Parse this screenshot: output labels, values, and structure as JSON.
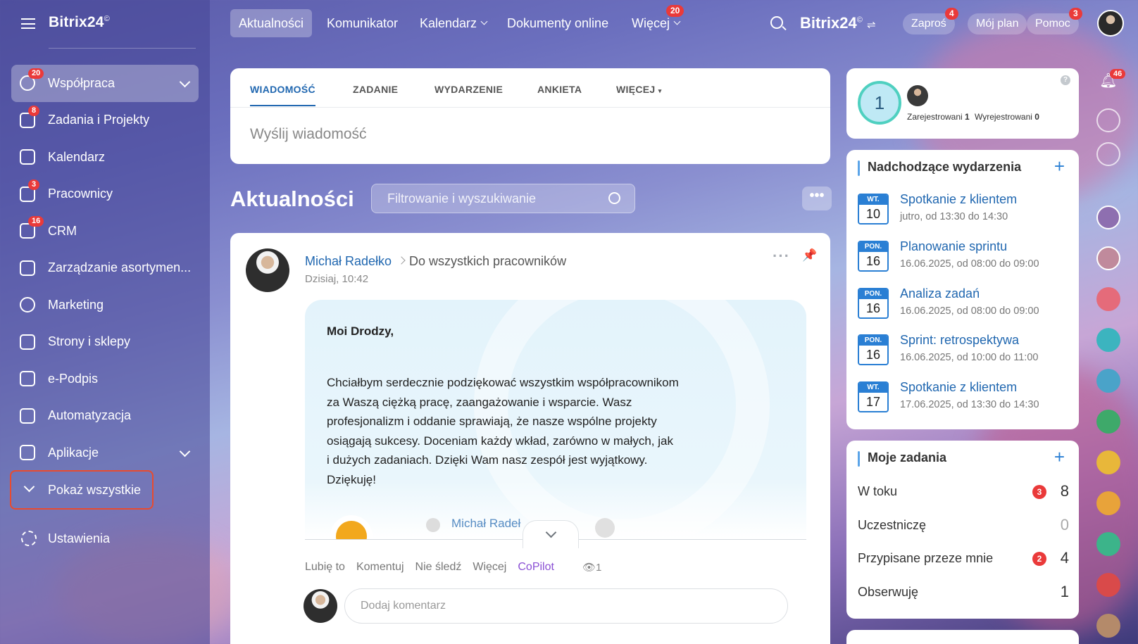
{
  "sidebar": {
    "logo": "Bitrix24",
    "items": [
      {
        "label": "Współpraca",
        "badge": "20"
      },
      {
        "label": "Zadania i Projekty",
        "badge": "8"
      },
      {
        "label": "Kalendarz",
        "badge": ""
      },
      {
        "label": "Pracownicy",
        "badge": "3"
      },
      {
        "label": "CRM",
        "badge": "16"
      },
      {
        "label": "Zarządzanie asortymen...",
        "badge": ""
      },
      {
        "label": "Marketing",
        "badge": ""
      },
      {
        "label": "Strony i sklepy",
        "badge": ""
      },
      {
        "label": "e-Podpis",
        "badge": ""
      },
      {
        "label": "Automatyzacja",
        "badge": ""
      },
      {
        "label": "Aplikacje",
        "badge": ""
      }
    ],
    "show_all": "Pokaż wszystkie",
    "settings": "Ustawienia"
  },
  "header": {
    "tabs": [
      "Aktualności",
      "Komunikator",
      "Kalendarz",
      "Dokumenty online",
      "Więcej"
    ],
    "more_badge": "20",
    "brand": "Bitrix24",
    "invite": "Zaproś",
    "invite_badge": "4",
    "my_plan": "Mój plan",
    "help": "Pomoc",
    "help_badge": "3"
  },
  "composer": {
    "tabs": [
      "WIADOMOŚĆ",
      "ZADANIE",
      "WYDARZENIE",
      "ANKIETA",
      "WIĘCEJ"
    ],
    "placeholder": "Wyślij wiadomość"
  },
  "feed": {
    "title": "Aktualności",
    "filter_placeholder": "Filtrowanie i wyszukiwanie",
    "dots": "•••"
  },
  "post": {
    "author": "Michał Radełko",
    "recipient": "Do wszystkich pracowników",
    "time": "Dzisiaj, 10:42",
    "greeting": "Moi Drodzy,",
    "body": "Chciałbym serdecznie podziękować wszystkim współpracownikom za Waszą ciężką pracę, zaangażowanie i wsparcie. Wasz profesjonalizm i oddanie sprawiają, że nasze wspólne projekty osiągają sukcesy. Doceniam każdy wkład, zarówno w małych, jak i dużych zadaniach. Dzięki Wam nasz zespół jest wyjątkowy. Dziękuję!",
    "mention": "Michał Radeł",
    "actions": [
      "Lubię to",
      "Komentuj",
      "Nie śledź",
      "Więcej",
      "CoPilot"
    ],
    "views": "1",
    "comment_placeholder": "Dodaj komentarz"
  },
  "online": {
    "count": "1",
    "registered_label": "Zarejestrowani",
    "registered": "1",
    "unregistered_label": "Wyrejestrowani",
    "unregistered": "0"
  },
  "events": {
    "title": "Nadchodzące wydarzenia",
    "items": [
      {
        "month": "WT.",
        "day": "10",
        "title": "Spotkanie z klientem",
        "when": "jutro, od 13:30 do 14:30"
      },
      {
        "month": "PON.",
        "day": "16",
        "title": "Planowanie sprintu",
        "when": "16.06.2025, od 08:00 do 09:00"
      },
      {
        "month": "PON.",
        "day": "16",
        "title": "Analiza zadań",
        "when": "16.06.2025, od 08:00 do 09:00"
      },
      {
        "month": "PON.",
        "day": "16",
        "title": "Sprint: retrospektywa",
        "when": "16.06.2025, od 10:00 do 11:00"
      },
      {
        "month": "WT.",
        "day": "17",
        "title": "Spotkanie z klientem",
        "when": "17.06.2025, od 13:30 do 14:30"
      }
    ]
  },
  "tasks": {
    "title": "Moje zadania",
    "rows": [
      {
        "label": "W toku",
        "badge": "3",
        "count": "8"
      },
      {
        "label": "Uczestniczę",
        "badge": "",
        "count": "0"
      },
      {
        "label": "Przypisane przeze mnie",
        "badge": "2",
        "count": "4"
      },
      {
        "label": "Obserwuję",
        "badge": "",
        "count": "1"
      }
    ]
  },
  "rail": {
    "notifications_badge": "46"
  }
}
